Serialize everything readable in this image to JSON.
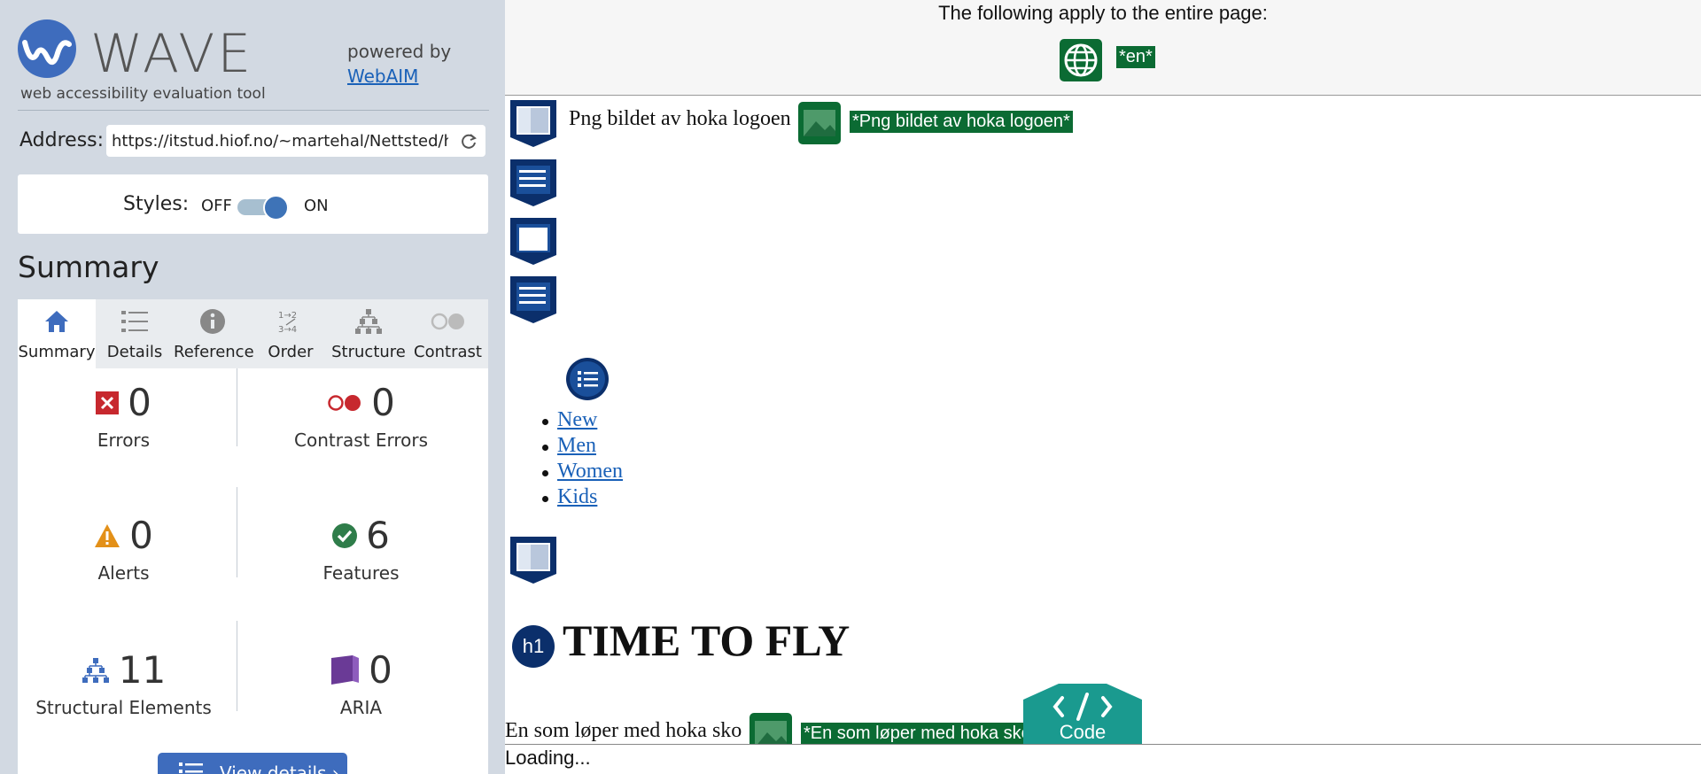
{
  "app": {
    "name": "WAVE",
    "tagline": "web accessibility evaluation tool",
    "powered_by": "powered by",
    "powered_link": "WebAIM"
  },
  "address": {
    "label": "Address:",
    "value": "https://itstud.hiof.no/~martehal/Nettsted/h"
  },
  "styles": {
    "label": "Styles:",
    "off": "OFF",
    "on": "ON",
    "state": "on"
  },
  "summary": {
    "title": "Summary",
    "tabs": [
      {
        "label": "Summary",
        "icon": "home-icon"
      },
      {
        "label": "Details",
        "icon": "list-icon"
      },
      {
        "label": "Reference",
        "icon": "info-icon"
      },
      {
        "label": "Order",
        "icon": "order-icon"
      },
      {
        "label": "Structure",
        "icon": "structure-icon"
      },
      {
        "label": "Contrast",
        "icon": "contrast-icon"
      }
    ],
    "stats": {
      "errors": {
        "count": "0",
        "label": "Errors"
      },
      "contrast_errors": {
        "count": "0",
        "label": "Contrast Errors"
      },
      "alerts": {
        "count": "0",
        "label": "Alerts"
      },
      "features": {
        "count": "6",
        "label": "Features"
      },
      "structural": {
        "count": "11",
        "label": "Structural Elements"
      },
      "aria": {
        "count": "0",
        "label": "ARIA"
      }
    },
    "view_details": "View details ›"
  },
  "page": {
    "banner": "The following apply to the entire page:",
    "lang_tag": "*en*",
    "logo_text": "Png bildet av hoka logoen",
    "logo_alt": "*Png bildet av hoka logoen*",
    "nav_links": [
      "New",
      "Men",
      "Women",
      "Kids"
    ],
    "heading_badge": "h1",
    "heading": "TIME TO FLY",
    "runner_text": "En som løper med hoka sko",
    "runner_alt": "*En som løper med hoka sko*",
    "code_button": "Code",
    "loading": "Loading..."
  },
  "colors": {
    "feature_green": "#0b6b33",
    "structure_navy": "#0b2f6b",
    "accent_blue": "#3e73b7",
    "code_teal": "#1a9a8f"
  }
}
